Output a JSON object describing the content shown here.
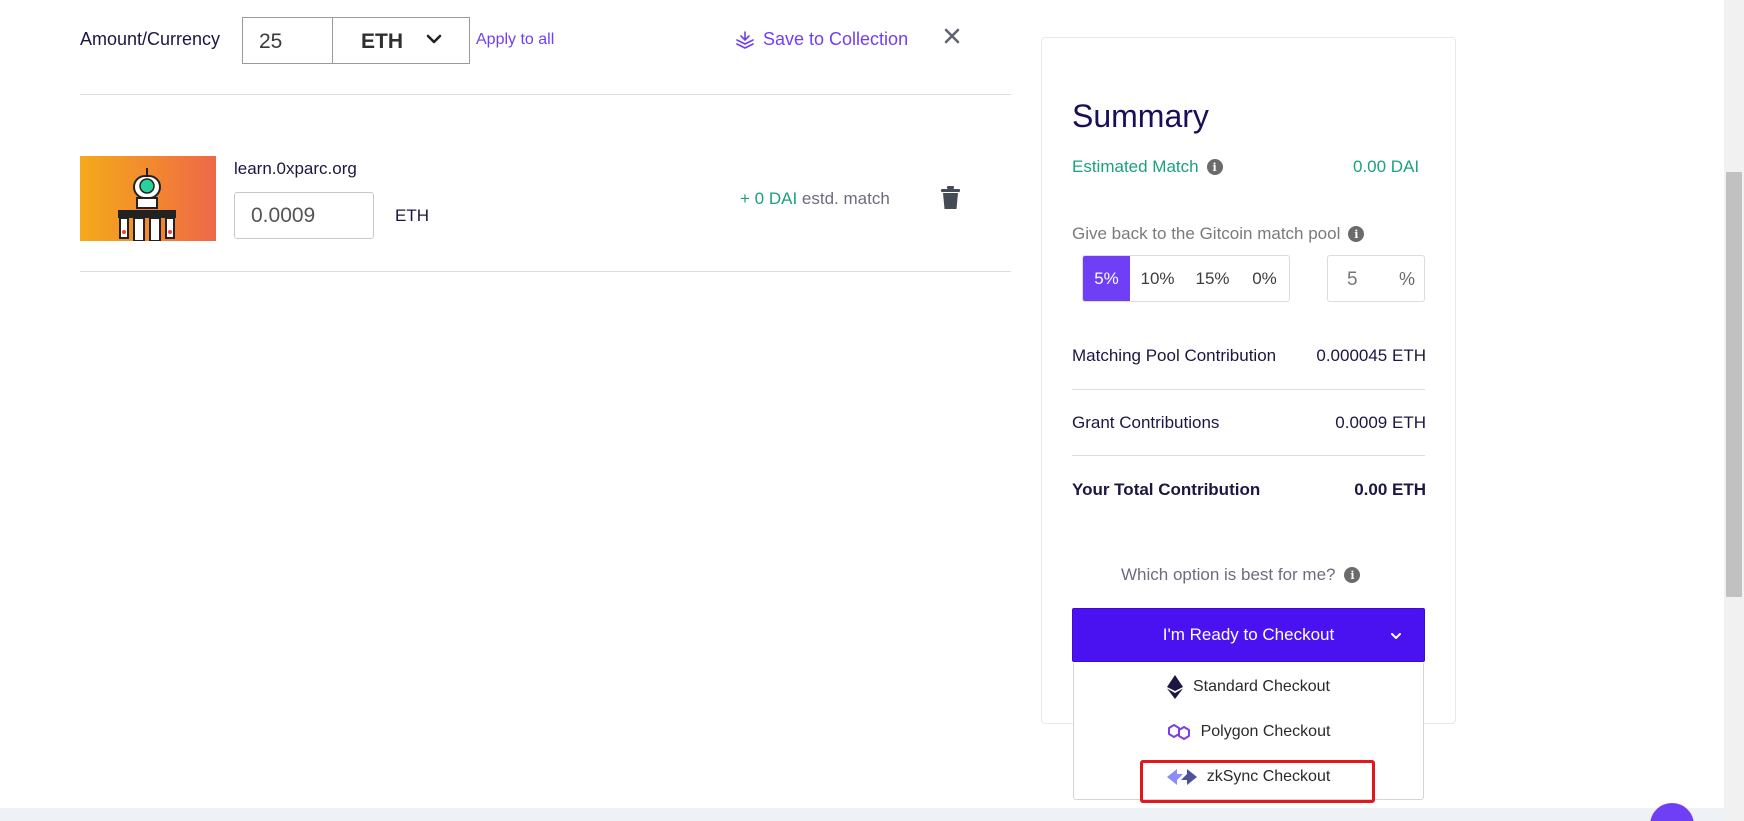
{
  "cart": {
    "amount_label": "Amount/Currency",
    "amount_value": "25",
    "currency": "ETH",
    "apply_all": "Apply to all",
    "save_collection": "Save to Collection"
  },
  "grant": {
    "title": "learn.0xparc.org",
    "amount": "0.0009",
    "currency": "ETH",
    "match_amount": "+ 0 DAI",
    "match_suffix": "estd. match"
  },
  "summary": {
    "title": "Summary",
    "estimated_match_label": "Estimated Match",
    "estimated_match_value": "0.00 DAI",
    "give_back_label": "Give back to the Gitcoin match pool",
    "percent_options": [
      "5%",
      "10%",
      "15%",
      "0%"
    ],
    "selected_percent": "5%",
    "custom_percent_value": "5",
    "custom_percent_unit": "%",
    "matching_pool_label": "Matching Pool Contribution",
    "matching_pool_value": "0.000045 ETH",
    "grant_contrib_label": "Grant Contributions",
    "grant_contrib_value": "0.0009 ETH",
    "total_label": "Your Total Contribution",
    "total_value": "0.00 ETH",
    "which_option": "Which option is best for me?",
    "checkout_button": "I'm Ready to Checkout",
    "checkout_options": [
      "Standard Checkout",
      "Polygon Checkout",
      "zkSync Checkout"
    ]
  },
  "colors": {
    "accent": "#6f3ff5",
    "checkout_bg": "#4a11f1",
    "match_green": "#1aa27d",
    "highlight_red": "#e3171b"
  },
  "icons": {
    "dropdown": "chevron-down-icon",
    "save": "collection-icon",
    "close": "close-icon",
    "delete": "trash-icon",
    "info": "info-icon",
    "standard": "ethereum-icon",
    "polygon": "polygon-icon",
    "zksync": "zksync-icon"
  }
}
